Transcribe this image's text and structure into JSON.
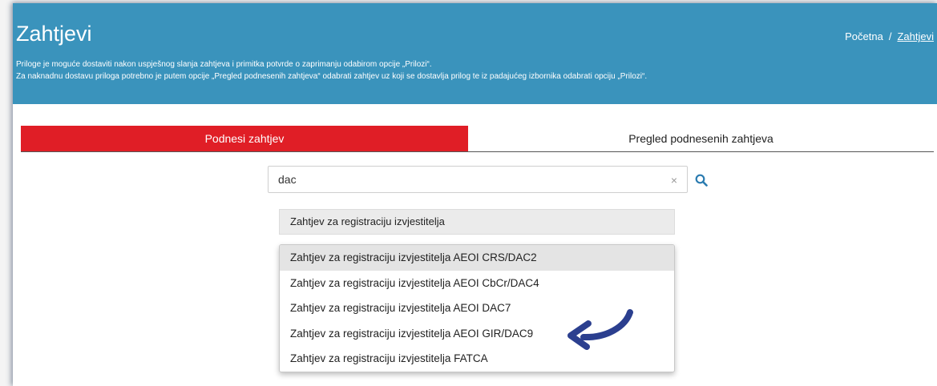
{
  "header": {
    "title": "Zahtjevi",
    "breadcrumb": {
      "home": "Početna",
      "separator": "/",
      "current": "Zahtjevi"
    },
    "info_line_1": "Priloge je moguće dostaviti nakon uspješnog slanja zahtjeva i primitka potvrde o zaprimanju odabirom opcije „Prilozi“.",
    "info_line_2": "Za naknadnu dostavu priloga potrebno je putem opcije „Pregled podnesenih zahtjeva“ odabrati zahtjev uz koji se dostavlja prilog te iz padajućeg izbornika odabrati opciju „Prilozi“."
  },
  "tabs": [
    {
      "label": "Podnesi zahtjev",
      "active": true
    },
    {
      "label": "Pregled podnesenih zahtjeva",
      "active": false
    }
  ],
  "search": {
    "value": "dac",
    "clear_icon": "×",
    "search_icon": "magnifier-icon"
  },
  "category_label": "Zahtjev za registraciju izvjestitelja",
  "options": [
    {
      "label": "Zahtjev za registraciju izvjestitelja AEOI CRS/DAC2",
      "highlighted": true
    },
    {
      "label": "Zahtjev za registraciju izvjestitelja AEOI CbCr/DAC4",
      "highlighted": false
    },
    {
      "label": "Zahtjev za registraciju izvjestitelja AEOI DAC7",
      "highlighted": false
    },
    {
      "label": "Zahtjev za registraciju izvjestitelja AEOI GIR/DAC9",
      "highlighted": false
    },
    {
      "label": "Zahtjev za registraciju izvjestitelja FATCA",
      "highlighted": false
    }
  ],
  "colors": {
    "header_bg": "#3a93bc",
    "active_tab_bg": "#e01e26",
    "arrow": "#2b3f8f",
    "search_icon": "#2a7bb0"
  }
}
